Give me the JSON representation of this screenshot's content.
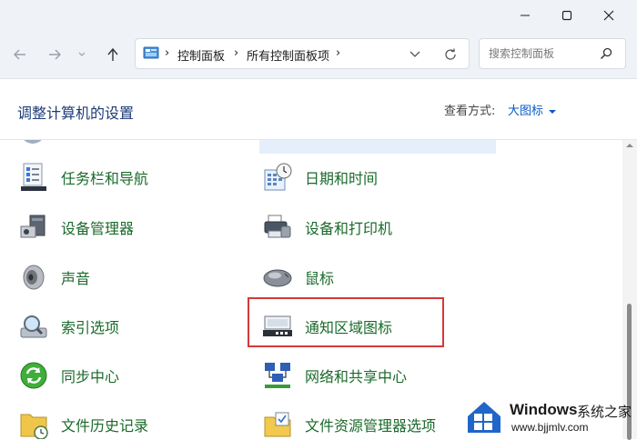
{
  "window": {
    "controls": [
      "minimize-icon",
      "maximize-icon",
      "close-icon"
    ]
  },
  "nav": {
    "breadcrumb": [
      "控制面板",
      "所有控制面板项"
    ],
    "search_placeholder": "搜索控制面板"
  },
  "header": {
    "title": "调整计算机的设置",
    "view_by_label": "查看方式:",
    "view_by_value": "大图标"
  },
  "items": [
    {
      "label": "任务栏和导航",
      "icon": "taskbar-icon"
    },
    {
      "label": "日期和时间",
      "icon": "calendar-clock-icon"
    },
    {
      "label": "设备管理器",
      "icon": "device-manager-icon"
    },
    {
      "label": "设备和打印机",
      "icon": "printer-icon"
    },
    {
      "label": "声音",
      "icon": "speaker-icon"
    },
    {
      "label": "鼠标",
      "icon": "mouse-icon"
    },
    {
      "label": "索引选项",
      "icon": "magnifier-drive-icon"
    },
    {
      "label": "通知区域图标",
      "icon": "notification-area-icon"
    },
    {
      "label": "同步中心",
      "icon": "sync-icon"
    },
    {
      "label": "网络和共享中心",
      "icon": "network-icon"
    },
    {
      "label": "文件历史记录",
      "icon": "file-history-icon"
    },
    {
      "label": "文件资源管理器选项",
      "icon": "folder-options-icon"
    }
  ],
  "watermark": {
    "brand": "Windows",
    "cn": "系统之家",
    "url": "www.bjjmlv.com"
  },
  "colors": {
    "accent": "#0a5ac8",
    "item_text": "#1a6a2a",
    "highlight_box": "#d33a3a"
  }
}
